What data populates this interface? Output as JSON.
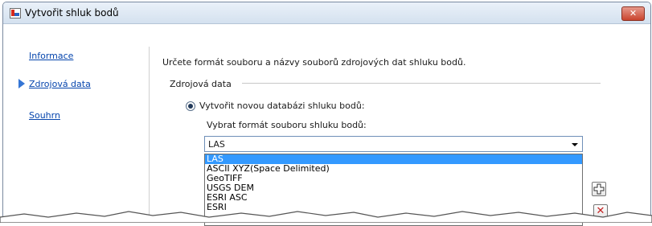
{
  "window": {
    "title": "Vytvořit shluk bodů",
    "close_glyph": "✕"
  },
  "sidebar": {
    "items": [
      {
        "label": "Informace",
        "active": false
      },
      {
        "label": "Zdrojová data",
        "active": true
      },
      {
        "label": "Souhrn",
        "active": false
      }
    ]
  },
  "main": {
    "description": "Určete formát souboru a názvy souborů zdrojových dat shluku bodů.",
    "group_title": "Zdrojová data",
    "radio_label": "Vytvořit novou databázi shluku bodů:",
    "format_label": "Vybrat formát souboru shluku bodů:",
    "combo": {
      "value": "LAS",
      "options": [
        "LAS",
        "ASCII XYZ(Space Delimited)",
        "GeoTIFF",
        "USGS DEM",
        "ESRI ASC",
        "ESRI"
      ],
      "selected_index": 0
    }
  },
  "buttons": {
    "add_icon": "plus-icon",
    "remove_glyph": "✕"
  },
  "colors": {
    "link": "#0645ad",
    "selection": "#3399ff",
    "nav_arrow": "#3576d5"
  }
}
